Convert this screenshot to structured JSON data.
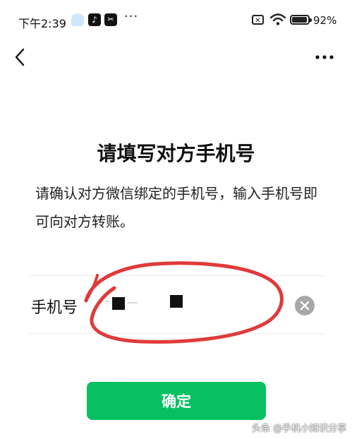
{
  "status_bar": {
    "time": "下午2:39",
    "battery": "92%",
    "icons": [
      "cloud-icon",
      "tiktok-icon",
      "capcut-icon",
      "more-dots-icon",
      "sim-icon",
      "wifi-icon",
      "battery-icon"
    ]
  },
  "nav": {
    "back_icon": "chevron-left-icon",
    "more_icon": "more-horizontal-icon"
  },
  "page": {
    "title": "请填写对方手机号",
    "description": "请确认对方微信绑定的手机号，输入手机号即可向对方转账。"
  },
  "phone_field": {
    "label": "手机号",
    "value_masked": true,
    "clear_icon": "clear-icon"
  },
  "confirm_button": {
    "label": "确定"
  },
  "colors": {
    "accent": "#07c160",
    "annotation": "#e03a3a",
    "clear_button": "#a8a8a8"
  },
  "watermark": "头条 @手机小知识分享"
}
